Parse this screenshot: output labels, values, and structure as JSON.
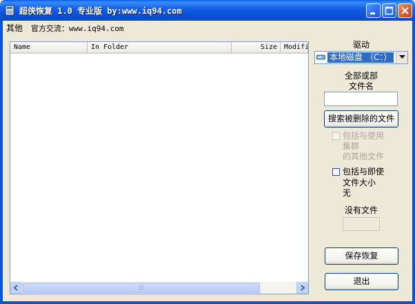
{
  "window": {
    "title": "超侠恢复 1.0 专业版 by:www.iq94.com",
    "controls": [
      "minimize-icon",
      "maximize-icon",
      "close-icon"
    ],
    "accent": "#0a52d8"
  },
  "menu": {
    "other": "其他",
    "official": "官方交流：www.iq94.com"
  },
  "list": {
    "columns": [
      "Name",
      "In Folder",
      "Size",
      "Modifi"
    ],
    "rows": []
  },
  "drive": {
    "label": "驱动",
    "selected": "本地磁盘 （C：）",
    "icon": "hard-drive-icon"
  },
  "filename": {
    "label_line1": "全部或部",
    "label_line2": "文件名",
    "value": ""
  },
  "search_button": "搜索被删除的文件",
  "include_used": {
    "line1": "包括与使用",
    "line2": "集群",
    "line3": "的其他文件",
    "checked": false,
    "enabled": false
  },
  "include_immediate": {
    "line1": "包括与即使",
    "line2": "文件大小",
    "line3": "无",
    "checked": false,
    "enabled": true
  },
  "status": {
    "label": "没有文件",
    "value": ""
  },
  "save_button": "保存恢复",
  "exit_button": "退出"
}
